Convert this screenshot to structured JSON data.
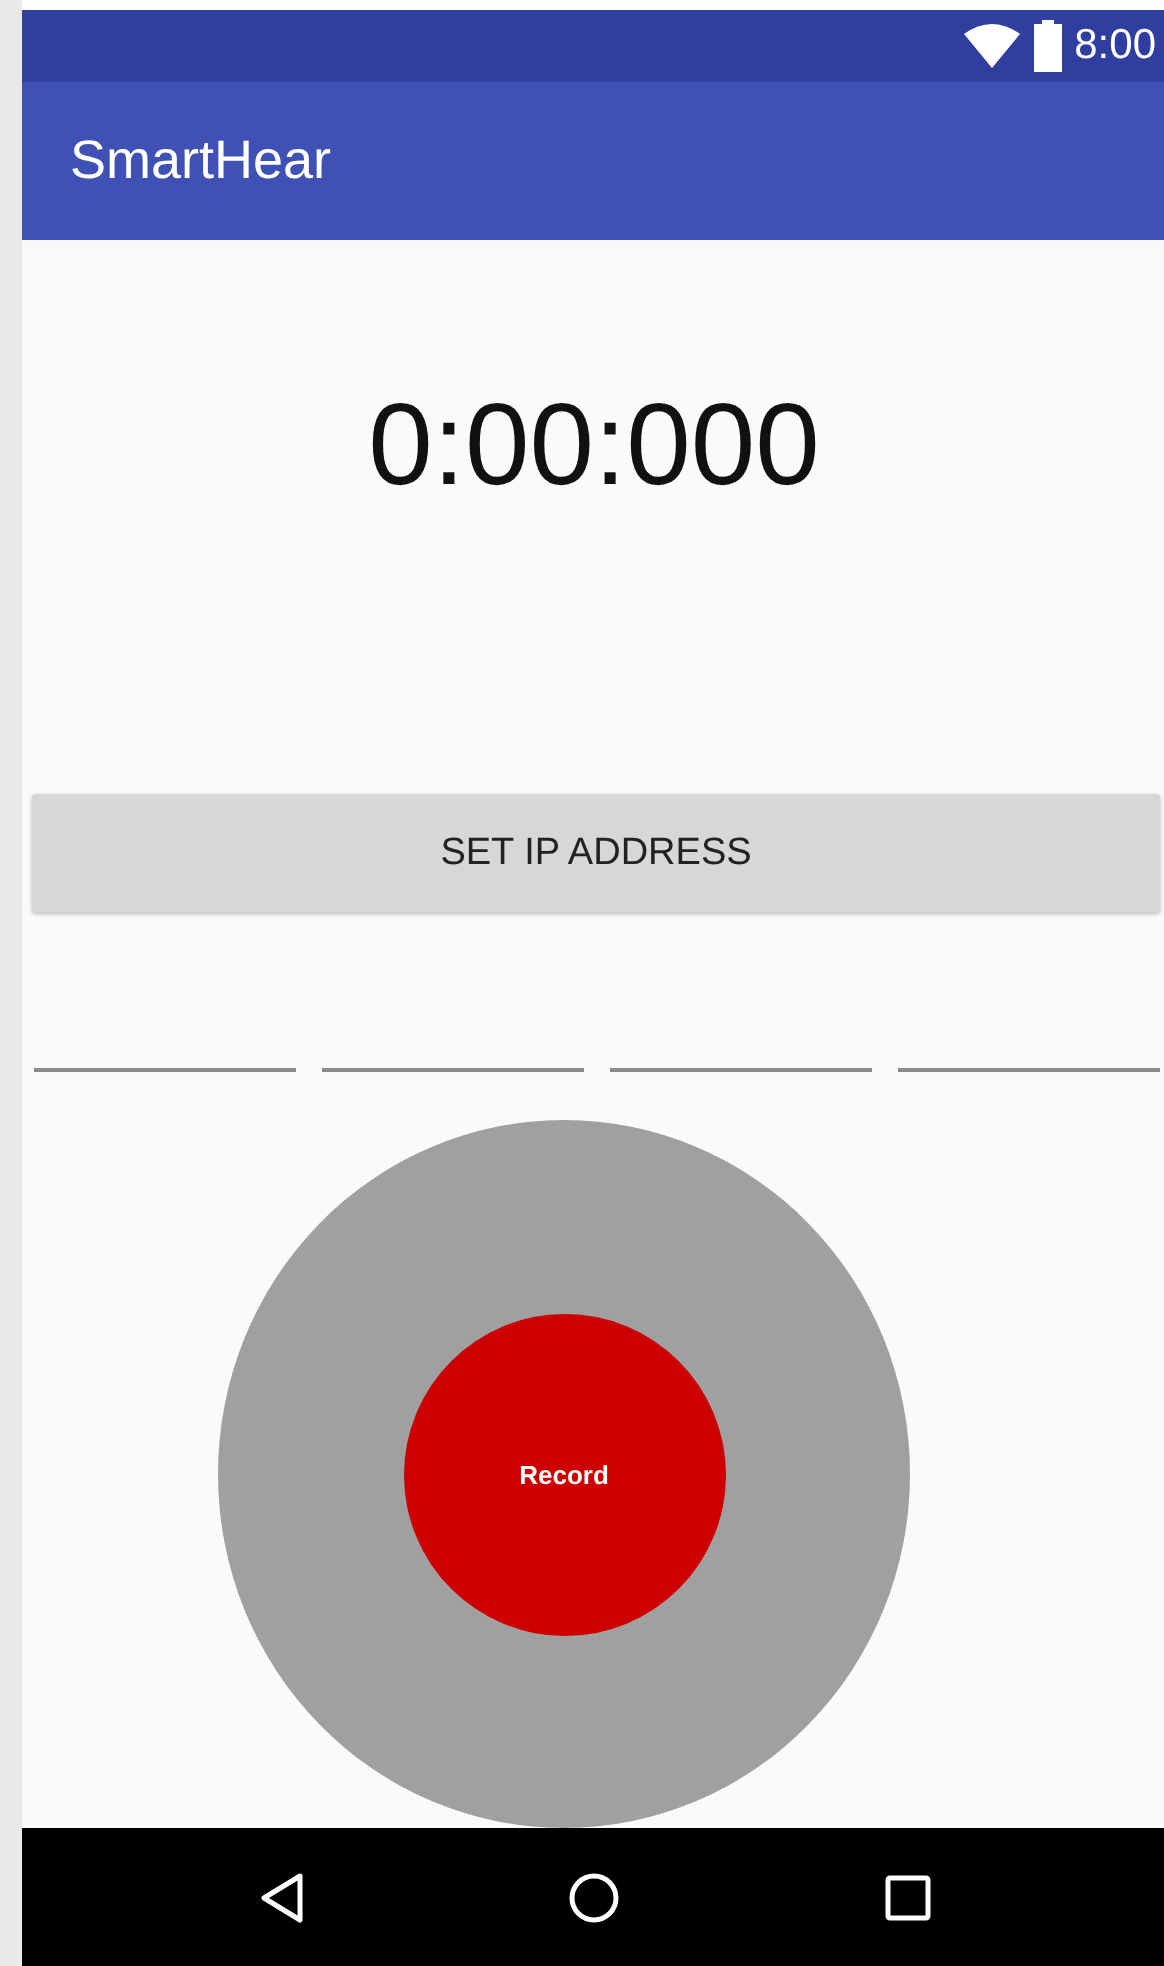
{
  "status_bar": {
    "time": "8:00"
  },
  "app_bar": {
    "title": "SmartHear"
  },
  "timer": "0:00:000",
  "set_ip_button": "SET IP ADDRESS",
  "ip_fields": [
    {
      "kind": "field"
    },
    {
      "kind": "field"
    },
    {
      "kind": "field"
    },
    {
      "kind": "field"
    }
  ],
  "record_button": "Record",
  "nav_bar": {
    "buttons": [
      {
        "kind": "back"
      },
      {
        "kind": "home"
      },
      {
        "kind": "recents"
      }
    ]
  }
}
